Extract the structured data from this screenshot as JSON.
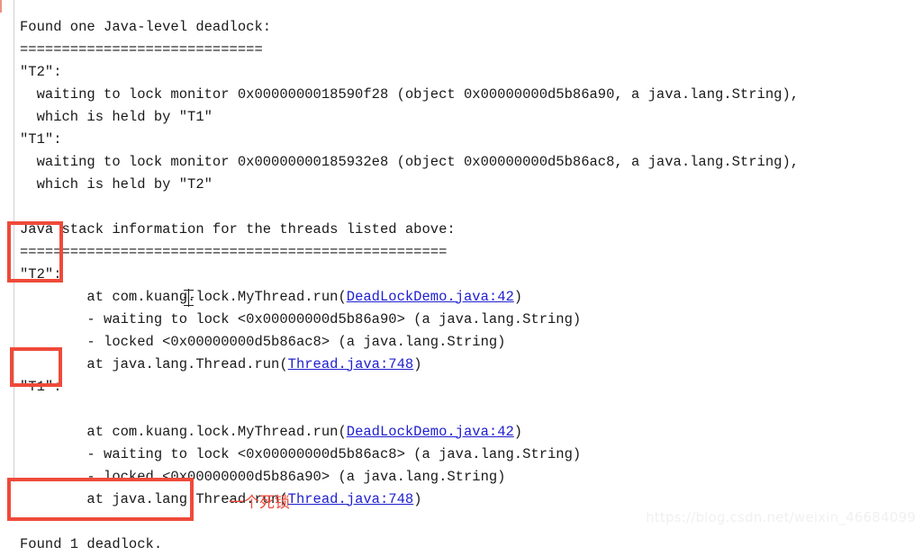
{
  "console": {
    "lines": [
      {
        "text": "Found one Java-level deadlock:"
      },
      {
        "text": "============================="
      },
      {
        "text": "\"T2\":"
      },
      {
        "text": "  waiting to lock monitor 0x0000000018590f28 (object 0x00000000d5b86a90, a java.lang.String),"
      },
      {
        "text": "  which is held by \"T1\""
      },
      {
        "text": "\"T1\":"
      },
      {
        "text": "  waiting to lock monitor 0x00000000185932e8 (object 0x00000000d5b86ac8, a java.lang.String),"
      },
      {
        "text": "  which is held by \"T2\""
      },
      {
        "text": ""
      },
      {
        "text": "Java stack information for the threads listed above:"
      },
      {
        "text": "==================================================="
      },
      {
        "text": "\"T2\":"
      },
      {
        "segments": [
          {
            "text": "        at com.kuang.lock.MyThread.run("
          },
          {
            "text": "DeadLockDemo.java:42",
            "link": true
          },
          {
            "text": ")"
          }
        ]
      },
      {
        "text": "        - waiting to lock <0x00000000d5b86a90> (a java.lang.String)"
      },
      {
        "text": "        - locked <0x00000000d5b86ac8> (a java.lang.String)"
      },
      {
        "segments": [
          {
            "text": "        at java.lang.Thread.run("
          },
          {
            "text": "Thread.java:748",
            "link": true
          },
          {
            "text": ")"
          }
        ]
      },
      {
        "text": "\"T1\":"
      },
      {
        "text": ""
      },
      {
        "segments": [
          {
            "text": "        at com.kuang.lock.MyThread.run("
          },
          {
            "text": "DeadLockDemo.java:42",
            "link": true
          },
          {
            "text": ")"
          }
        ]
      },
      {
        "text": "        - waiting to lock <0x00000000d5b86ac8> (a java.lang.String)"
      },
      {
        "text": "        - locked <0x00000000d5b86a90> (a java.lang.String)"
      },
      {
        "segments": [
          {
            "text": "        at java.lang.Thread.run("
          },
          {
            "text": "Thread.java:748",
            "link": true
          },
          {
            "text": ")"
          }
        ]
      },
      {
        "text": ""
      },
      {
        "text": "Found 1 deadlock."
      }
    ]
  },
  "annotations": {
    "highlight_thread_2": "\"T2\":",
    "highlight_thread_1": "\"T1\":",
    "highlight_result": "Found 1 deadlock.",
    "note_cn": "一个死锁",
    "box_color": "#ef4a3a",
    "note_color": "#ef4a3a"
  },
  "watermark": {
    "text": "https://blog.csdn.net/weixin_46684099"
  },
  "theme": {
    "background": "#ffffff",
    "text_color": "#1a1a1a",
    "link_color": "#2020d0",
    "divider_color": "#d0d0d0"
  }
}
